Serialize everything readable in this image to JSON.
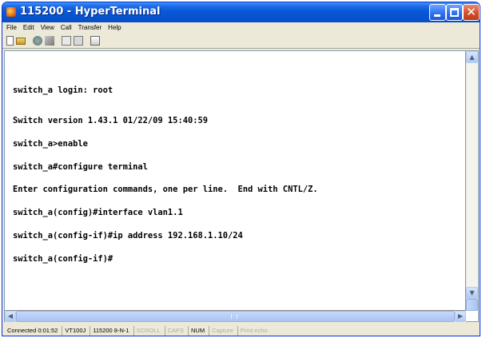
{
  "window": {
    "title": "115200 - HyperTerminal"
  },
  "menubar": {
    "items": [
      "File",
      "Edit",
      "View",
      "Call",
      "Transfer",
      "Help"
    ]
  },
  "toolbar": {
    "buttons": [
      "new-icon",
      "open-icon",
      "call-icon",
      "disconnect-icon",
      "send-icon",
      "receive-icon",
      "properties-icon"
    ]
  },
  "terminal": {
    "lines": [
      "switch_a login: root",
      "Switch version 1.43.1 01/22/09 15:40:59",
      "switch_a>enable",
      "switch_a#configure terminal",
      "Enter configuration commands, one per line.  End with CNTL/Z.",
      "switch_a(config)#interface vlan1.1",
      "switch_a(config-if)#ip address 192.168.1.10/24",
      "switch_a(config-if)#"
    ]
  },
  "statusbar": {
    "connected": "Connected 0:01:52",
    "emulation": "VT100J",
    "port_settings": "115200 8-N-1",
    "scroll": "SCROLL",
    "caps": "CAPS",
    "num": "NUM",
    "capture": "Capture",
    "print_echo": "Print echo"
  },
  "colors": {
    "titlebar": "#0a58d8",
    "close_button": "#d4502a",
    "window_frame": "#ece9d8",
    "terminal_bg": "#ffffff",
    "terminal_text": "#000000"
  }
}
